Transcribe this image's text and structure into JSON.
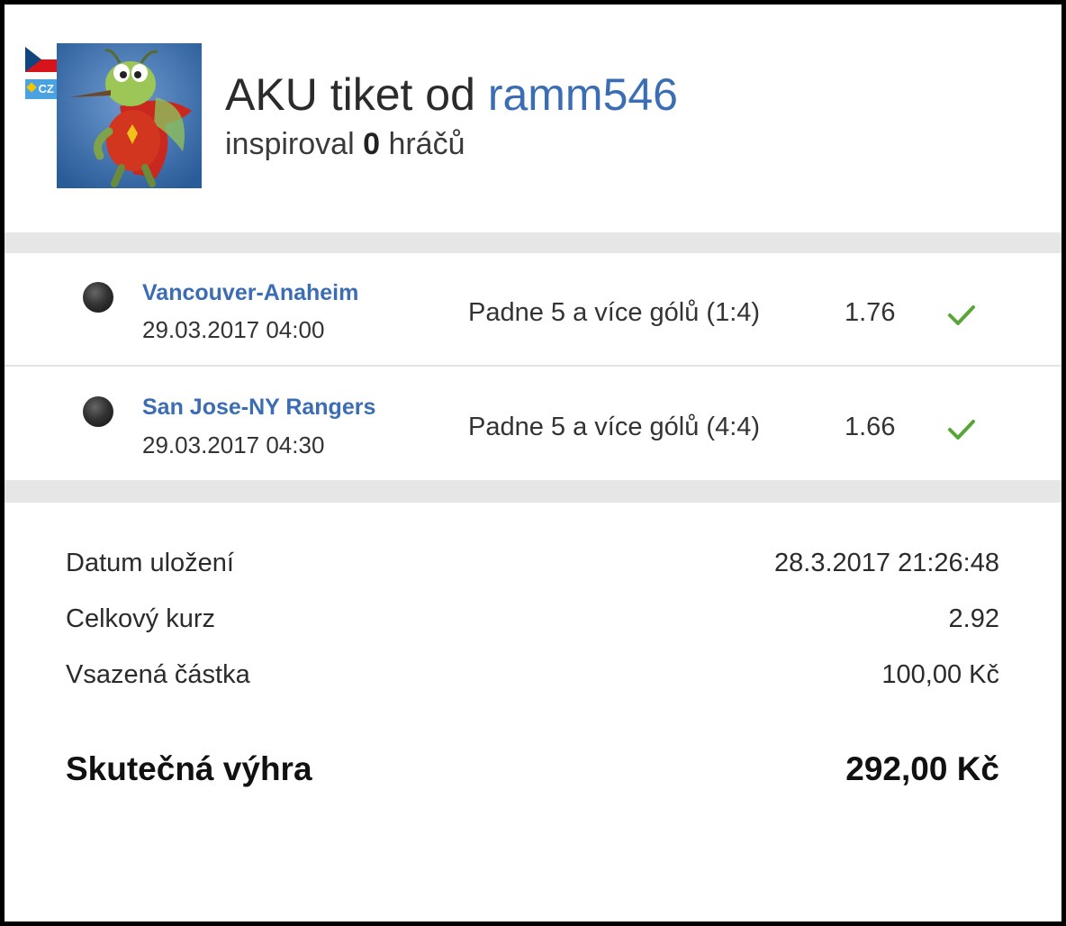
{
  "header": {
    "country_code": "CZ",
    "title_prefix": "AKU tiket od",
    "username": "ramm546",
    "inspired_prefix": "inspiroval",
    "inspired_count": "0",
    "inspired_suffix": "hráčů"
  },
  "bets": [
    {
      "match": "Vancouver-Anaheim",
      "date": "29.03.2017 04:00",
      "pick": "Padne 5 a více gólů (1:4)",
      "odd": "1.76",
      "status": "won"
    },
    {
      "match": "San Jose-NY Rangers",
      "date": "29.03.2017 04:30",
      "pick": "Padne 5 a více gólů (4:4)",
      "odd": "1.66",
      "status": "won"
    }
  ],
  "summary": {
    "saved_label": "Datum uložení",
    "saved_value": "28.3.2017 21:26:48",
    "odds_label": "Celkový kurz",
    "odds_value": "2.92",
    "stake_label": "Vsazená částka",
    "stake_value": "100,00 Kč",
    "win_label": "Skutečná výhra",
    "win_value": "292,00 Kč"
  },
  "colors": {
    "link": "#3b6db5",
    "check": "#5aa537",
    "separator": "#e6e6e6"
  },
  "icons": {
    "flag": "czech-flag-icon",
    "avatar": "hornet-mascot-avatar",
    "status": "check-icon",
    "sport": "hockey-puck-icon"
  }
}
